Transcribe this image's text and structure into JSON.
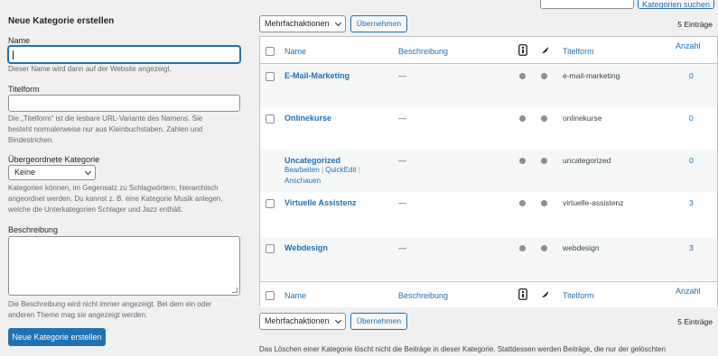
{
  "form": {
    "title": "Neue Kategorie erstellen",
    "name_label": "Name",
    "name_value": "",
    "name_desc": "Dieser Name wird dann auf der Website angezeigt.",
    "slug_label": "Titelform",
    "slug_value": "",
    "slug_desc_1": "Die „Titelform“ ist die lesbare URL-Variante des Namens. Sie",
    "slug_desc_2": "besteht normalerweise nur aus Kleinbuchstaben, Zahlen und",
    "slug_desc_3": "Bindestrichen.",
    "parent_label": "Übergeordnete Kategorie",
    "parent_value": "Keine",
    "parent_desc_1": "Kategorien können, im Gegensatz zu Schlagwörtern, hierarchisch",
    "parent_desc_2": "angeordnet werden. Du kannst z. B. eine Kategorie Musik anlegen,",
    "parent_desc_3": "welche die Unterkategorien Schlager und Jazz enthält.",
    "description_label": "Beschreibung",
    "description_desc_1": "Die Beschreibung wird nicht immer angezeigt. Bei dem ein oder",
    "description_desc_2": "anderen Theme mag sie angezeigt werden.",
    "submit_label": "Neue Kategorie erstellen"
  },
  "search": {
    "button_label": "Kategorien suchen",
    "value": ""
  },
  "bulk": {
    "select_value": "Mehrfachaktionen",
    "apply_label": "Übernehmen",
    "count": "5 Einträge"
  },
  "table": {
    "headers": {
      "name": "Name",
      "description": "Beschreibung",
      "slug": "Titelform",
      "count": "Anzahl"
    },
    "rows": [
      {
        "name": "E-Mail-Marketing",
        "description": "—",
        "slug": "e-mail-marketing",
        "count": "0"
      },
      {
        "name": "Onlinekurse",
        "description": "—",
        "slug": "onlinekurse",
        "count": "0"
      },
      {
        "name": "Uncategorized",
        "description": "—",
        "slug": "uncategorized",
        "count": "0"
      },
      {
        "name": "Virtuelle Assistenz",
        "description": "—",
        "slug": "virtuelle-assistenz",
        "count": "3"
      },
      {
        "name": "Webdesign",
        "description": "—",
        "slug": "webdesign",
        "count": "3"
      }
    ],
    "row_actions": {
      "edit": "Bearbeiten",
      "quickedit": "QuickEdit",
      "view": "Anschauen",
      "sep": "|"
    }
  },
  "notice": "Das Löschen einer Kategorie löscht nicht die Beiträge in dieser Kategorie. Stattdessen werden Beiträge, die nur der gelöschten",
  "icons": {
    "metaindex": "metaindex-column-icon",
    "feather": "feather-column-icon",
    "dot_color": "#8c8f94"
  },
  "colors": {
    "accent": "#2271b1",
    "background": "#f0f0f1"
  }
}
